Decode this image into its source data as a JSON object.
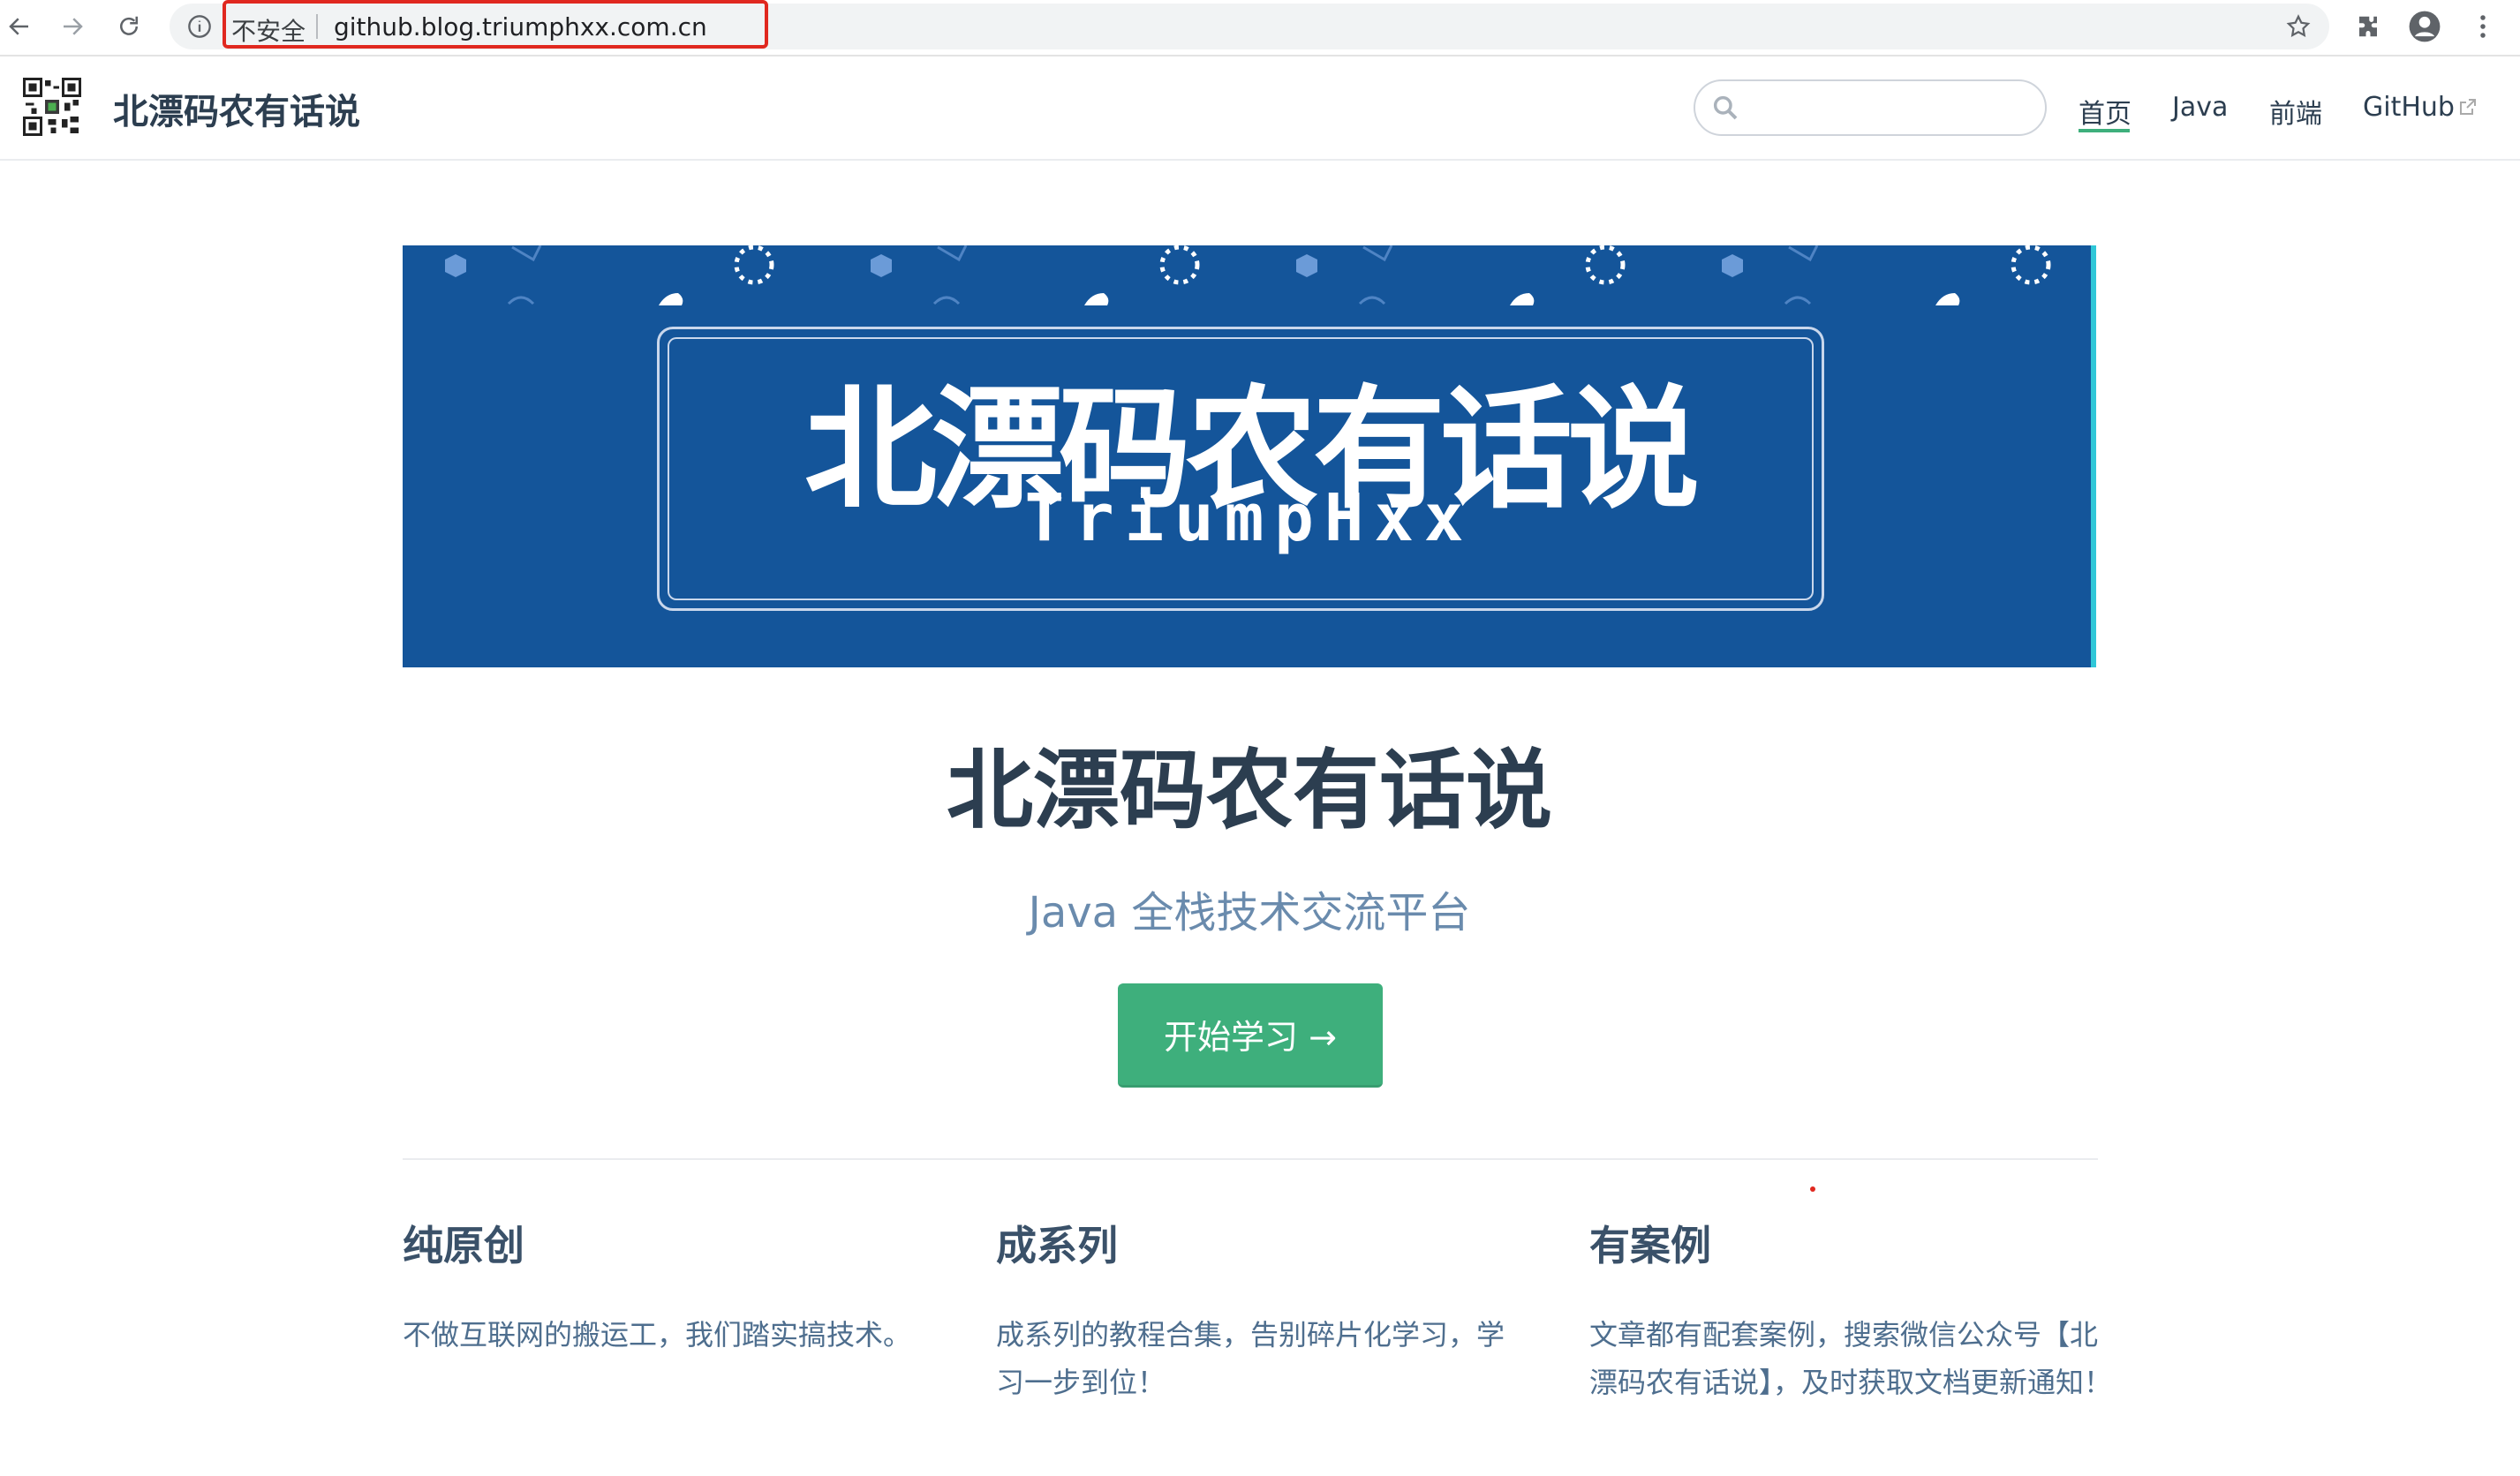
{
  "browser": {
    "security_label": "不安全",
    "url": "github.blog.triumphxx.com.cn",
    "icons": [
      "back-arrow-icon",
      "forward-arrow-icon",
      "reload-icon",
      "info-icon",
      "star-icon",
      "extensions-icon",
      "profile-icon",
      "menu-icon"
    ]
  },
  "navbar": {
    "site_title": "北漂码农有话说",
    "search_placeholder": "",
    "links": [
      {
        "label": "首页",
        "active": true
      },
      {
        "label": "Java",
        "active": false
      },
      {
        "label": "前端",
        "active": false
      },
      {
        "label": "GitHub",
        "active": false,
        "external": true
      }
    ]
  },
  "hero": {
    "banner_title": "北漂码农有话说",
    "banner_subtitle": "TriumpHxx",
    "title": "北漂码农有话说",
    "description": "Java 全栈技术交流平台",
    "action_label": "开始学习 →"
  },
  "features": [
    {
      "title": "纯原创",
      "details": "不做互联网的搬运工，我们踏实搞技术。"
    },
    {
      "title": "成系列",
      "details": "成系列的教程合集，告别碎片化学习，学习一步到位！"
    },
    {
      "title": "有案例",
      "details": "文章都有配套案例，搜索微信公众号【北漂码农有话说】，及时获取文档更新通知！"
    }
  ],
  "colors": {
    "accent": "#3eaf7c",
    "banner_bg": "#14559a",
    "text": "#2c3e50",
    "description": "#6a8bad",
    "url_highlight": "#e0281f"
  }
}
